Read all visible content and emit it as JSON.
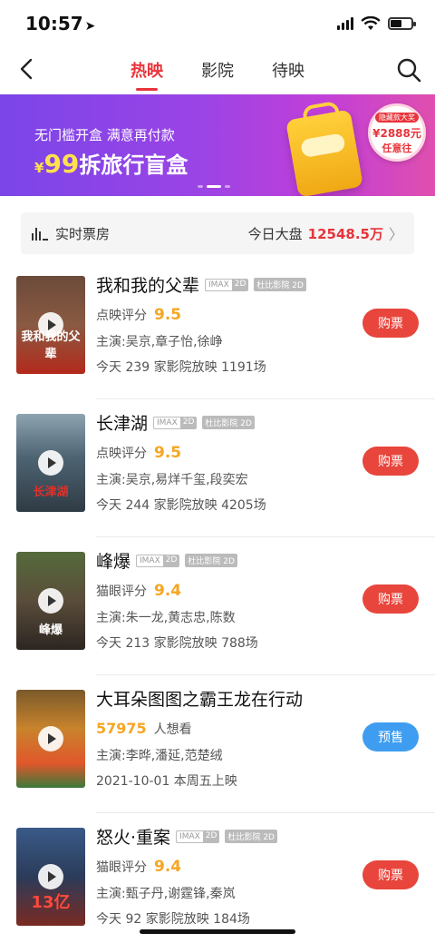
{
  "status_bar": {
    "time": "10:57"
  },
  "nav": {
    "tabs": [
      {
        "label": "热映",
        "active": true
      },
      {
        "label": "影院",
        "active": false
      },
      {
        "label": "待映",
        "active": false
      }
    ]
  },
  "banner": {
    "line1": "无门槛开盒 满意再付款",
    "yen": "¥",
    "price": "99",
    "product": "拆旅行盲盒",
    "badge_top": "隐藏款大奖",
    "badge_price": "¥2888元",
    "badge_bottom": "任意往"
  },
  "boxoffice": {
    "label": "实时票房",
    "today_label": "今日大盘",
    "today_value": "12548.5万"
  },
  "movies": [
    {
      "title": "我和我的父辈",
      "tags": [
        "IMAX",
        "2D",
        "杜比影院 2D"
      ],
      "score_label": "点映评分",
      "score": "9.5",
      "cast": "主演:吴京,章子怡,徐峥",
      "showing": "今天 239 家影院放映 1191场",
      "button": "购票",
      "poster_text": "我和我的父辈",
      "poster_color": "#b32a1c"
    },
    {
      "title": "长津湖",
      "tags": [
        "IMAX",
        "2D",
        "杜比影院 2D"
      ],
      "score_label": "点映评分",
      "score": "9.5",
      "cast": "主演:吴京,易烊千玺,段奕宏",
      "showing": "今天 244 家影院放映 4205场",
      "button": "购票",
      "poster_text": "长津湖",
      "poster_color": "#3c5566"
    },
    {
      "title": "峰爆",
      "tags": [
        "IMAX",
        "2D",
        "杜比影院 2D"
      ],
      "score_label": "猫眼评分",
      "score": "9.4",
      "cast": "主演:朱一龙,黄志忠,陈数",
      "showing": "今天 213 家影院放映 788场",
      "button": "购票",
      "poster_text": "峰爆",
      "poster_color": "#3f3a34"
    },
    {
      "title": "大耳朵图图之霸王龙在行动",
      "tags": [],
      "want_count": "57975",
      "want_label": "人想看",
      "cast": "主演:李晔,潘延,范楚绒",
      "showing": "2021-10-01 本周五上映",
      "button": "预售",
      "poster_text": "",
      "poster_color": "#d98a2a"
    },
    {
      "title": "怒火·重案",
      "tags": [
        "IMAX",
        "2D",
        "杜比影院 2D"
      ],
      "score_label": "猫眼评分",
      "score": "9.4",
      "cast": "主演:甄子丹,谢霆锋,秦岚",
      "showing": "今天 92 家影院放映 184场",
      "button": "购票",
      "poster_text": "13亿",
      "poster_color": "#2b3c5a"
    }
  ],
  "colors": {
    "accent": "#e8343b",
    "buy_button": "#e8453c",
    "presale_button": "#3e9df0",
    "score": "#f5a623"
  }
}
